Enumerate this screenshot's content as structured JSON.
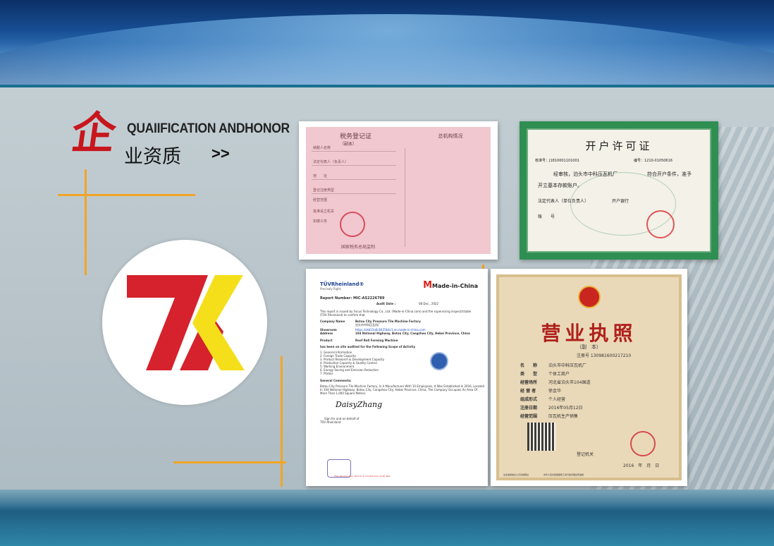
{
  "header": {
    "title_char": "企",
    "title_en": "QUAIIFICATION ANDHONOR",
    "title_zh": "业资质",
    "arrows": ">>"
  },
  "logo": {
    "letters": "ZK",
    "colors": {
      "red": "#d5222c",
      "yellow": "#f5df1b"
    }
  },
  "certificates": {
    "tax": {
      "title": "税务登记证",
      "subtitle": "（副本）",
      "right_title": "总机构情况",
      "labels": [
        "纳税人名称",
        "法定代表人（负责人）",
        "地　　址",
        "登记注册类型",
        "经营范围",
        "批准设立机关",
        "扣缴义务"
      ],
      "footer": "国家税务总局监制"
    },
    "kaihu": {
      "title": "开户许可证",
      "approval": "核准号：J1810001101001",
      "serial": "编号：1210-01050616",
      "line1": "经审核，泊头市中科压瓦机厂　　　　　　符合开户条件，准予",
      "line2": "开立基本存款账户。",
      "line3": "法定代表人（单位负责人）　　　　　　开户银行",
      "line4": "账　　号"
    },
    "tuv": {
      "brand": "TÜVRheinland®",
      "slogan": "Precisely Right.",
      "mic": "Made-in-China",
      "report_no": "Report Number: MIC-AS2226789",
      "audit_date_label": "Audit Date :",
      "audit_date": "08 Dec., 2022",
      "intro": "This report is issued by Focus Technology Co., Ltd. (Made-in-China.com) and the supervising inspect/ctable",
      "intro2": "(TÜV Rheinland) to confirm that",
      "company_label": "Company Name",
      "company": "Botou City Pressure Tile Machine Factory",
      "company_zh": "泊头市中科压瓦机厂",
      "showroom_label": "Showroom",
      "showroom": "https://zkb15a6c6435b4c1.en.made-in-china.com",
      "address_label": "Address",
      "address": "104 National Highway, Botou City, Cangzhou City, Hebei Province, China",
      "product_label": "Product",
      "product": "Roof Roll Forming Machine",
      "scope": "has been on site audited for the Following Scope of Activity",
      "items": [
        "1. General Information",
        "2. Foreign Trade Capacity",
        "3. Product Research & Development Capacity",
        "4. Production Capacity & Quality Control",
        "5. Working Environment",
        "6. Energy Saving and Emission Reduction",
        "7. Photos"
      ],
      "comments_label": "General Comments:",
      "comment1": "Botou City Pressure Tile Machine Factory, Is A Manufacturer With 10 Employees, It Was Established In 2016, Located",
      "comment2": "In 104 National Highway, Botou City, Cangzhou City, Hebei Province, China, The Company Occupies An Area Of",
      "comment3": "More Than 1,000 Square Meters.",
      "signature": "DaisyZhang",
      "signed": "Sign for and on behalf of",
      "signed2": "TÜV Rheinland",
      "red_note": "This report is only valid for 6 months from audit date"
    },
    "yingye": {
      "title": "营业执照",
      "subtitle": "（副　本）",
      "credit_code": "注册号 130981600217210",
      "rows": [
        [
          "名　　称",
          "泊头市中科压瓦机厂"
        ],
        [
          "类　　型",
          "个体工商户"
        ],
        [
          "经营场所",
          "河北省泊头市104国道"
        ],
        [
          "经 营 者",
          "徐金华"
        ],
        [
          "组成形式",
          "个人经营"
        ],
        [
          "注册日期",
          "2016年05月12日"
        ],
        [
          "经营范围",
          "压瓦机生产销售"
        ]
      ],
      "reg_office": "登记机关",
      "date": "2016　年　月　日",
      "footer": "企业信用信息公示系统网址　　　　　　　中华人民共和国国家工商行政管理总局监制"
    }
  }
}
